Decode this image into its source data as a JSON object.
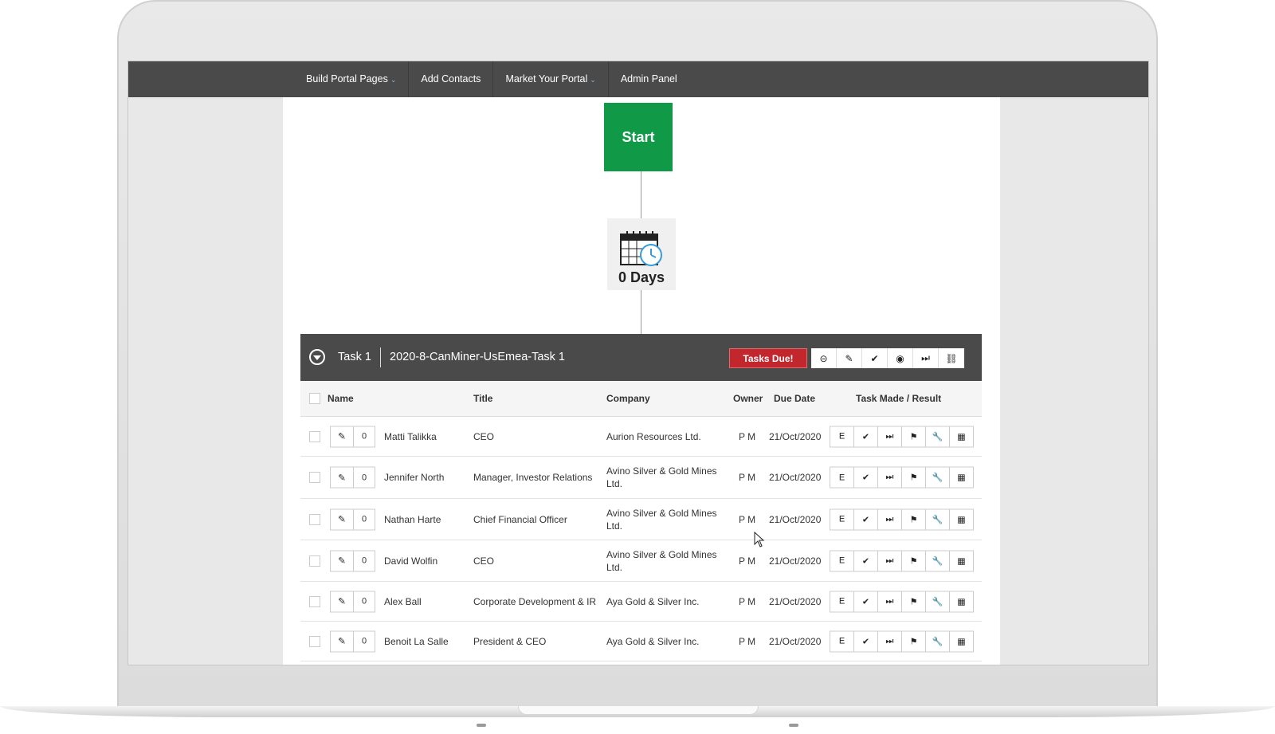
{
  "nav": {
    "items": [
      {
        "label": "Build Portal Pages",
        "dropdown": true
      },
      {
        "label": "Add Contacts",
        "dropdown": false
      },
      {
        "label": "Market Your Portal",
        "dropdown": true
      },
      {
        "label": "Admin Panel",
        "dropdown": false
      }
    ]
  },
  "flow": {
    "start_label": "Start",
    "wait_label": "0 Days",
    "wait_icon": "calendar-clock-icon"
  },
  "task": {
    "number_label": "Task 1",
    "name": "2020-8-CanMiner-UsEmea-Task 1",
    "due_badge": "Tasks Due!",
    "tools": [
      "minus-circle-icon",
      "pencil-icon",
      "check-icon",
      "eye-icon",
      "skip-icon",
      "link-icon"
    ]
  },
  "table": {
    "headers": {
      "name": "Name",
      "title": "Title",
      "company": "Company",
      "owner": "Owner",
      "due": "Due Date",
      "result": "Task Made / Result"
    },
    "row_tool_e": "E",
    "rows": [
      {
        "count": "0",
        "name": "Matti Talikka",
        "title": "CEO",
        "company": "Aurion Resources Ltd.",
        "owner": "P M",
        "due": "21/Oct/2020"
      },
      {
        "count": "0",
        "name": "Jennifer North",
        "title": "Manager, Investor Relations",
        "company": "Avino Silver & Gold Mines Ltd.",
        "owner": "P M",
        "due": "21/Oct/2020"
      },
      {
        "count": "0",
        "name": "Nathan Harte",
        "title": "Chief Financial Officer",
        "company": "Avino Silver & Gold Mines Ltd.",
        "owner": "P M",
        "due": "21/Oct/2020"
      },
      {
        "count": "0",
        "name": "David Wolfin",
        "title": "CEO",
        "company": "Avino Silver & Gold Mines Ltd.",
        "owner": "P M",
        "due": "21/Oct/2020"
      },
      {
        "count": "0",
        "name": "Alex Ball",
        "title": "Corporate Development & IR",
        "company": "Aya Gold & Silver Inc.",
        "owner": "P M",
        "due": "21/Oct/2020"
      },
      {
        "count": "0",
        "name": "Benoit La Salle",
        "title": "President & CEO",
        "company": "Aya Gold & Silver Inc.",
        "owner": "P M",
        "due": "21/Oct/2020"
      }
    ]
  },
  "colors": {
    "nav_bg": "#4a4a4a",
    "start_green": "#109a47",
    "tasks_due_red": "#c1272d",
    "calendar_blue": "#3a9ad9"
  }
}
